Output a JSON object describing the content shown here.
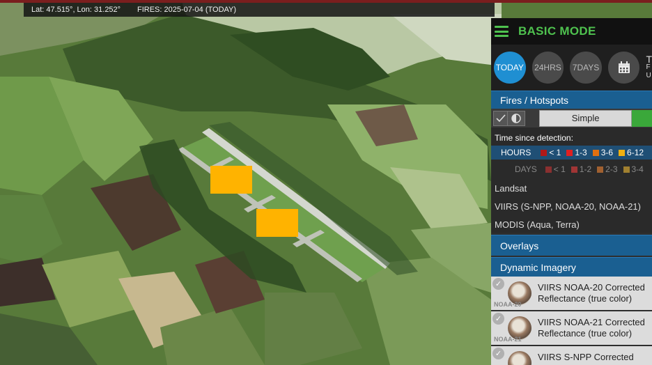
{
  "status_bar": {
    "coordinates": "Lat: 47.515°, Lon: 31.252°",
    "fires_date": "FIRES: 2025-07-04 (TODAY)"
  },
  "map": {
    "hotspot_color": "#ffb300",
    "hotspots": [
      {
        "id": "hotspot-1",
        "age_class": "6-12"
      },
      {
        "id": "hotspot-2",
        "age_class": "6-12"
      }
    ]
  },
  "panel": {
    "mode_title": "BASIC MODE",
    "time_buttons": [
      {
        "label": "TODAY",
        "active": true
      },
      {
        "label": "24HRS",
        "active": false
      },
      {
        "label": "7DAYS",
        "active": false
      }
    ],
    "calendar_icon": "calendar-icon",
    "calendar_label": {
      "line1": "T",
      "line2": "F",
      "line3": "U"
    },
    "fires_section": "Fires / Hotspots",
    "display_mode": "Simple",
    "time_since_detection": "Time since detection:",
    "hours_label": "HOURS",
    "hours_legend": [
      {
        "label": "< 1",
        "color": "#b01818"
      },
      {
        "label": "1-3",
        "color": "#e02020"
      },
      {
        "label": "3-6",
        "color": "#e07010"
      },
      {
        "label": "6-12",
        "color": "#f0b010"
      }
    ],
    "days_label": "DAYS",
    "days_legend": [
      {
        "label": "< 1",
        "color": "#8a3030"
      },
      {
        "label": "1-2",
        "color": "#a03535"
      },
      {
        "label": "2-3",
        "color": "#a06030"
      },
      {
        "label": "3-4",
        "color": "#a08030"
      }
    ],
    "sensors": [
      "Landsat",
      "VIIRS (S-NPP, NOAA-20, NOAA-21)",
      "MODIS (Aqua, Terra)"
    ],
    "overlays_section": "Overlays",
    "imagery_section": "Dynamic Imagery",
    "imagery_items": [
      {
        "badge": "NOAA-20",
        "title_line1": "VIIRS NOAA-20 Corrected",
        "title_line2": "Reflectance (true color)"
      },
      {
        "badge": "NOAA-21",
        "title_line1": "VIIRS NOAA-21 Corrected",
        "title_line2": "Reflectance (true color)"
      },
      {
        "badge": "",
        "title_line1": "VIIRS S-NPP Corrected",
        "title_line2": ""
      }
    ]
  }
}
